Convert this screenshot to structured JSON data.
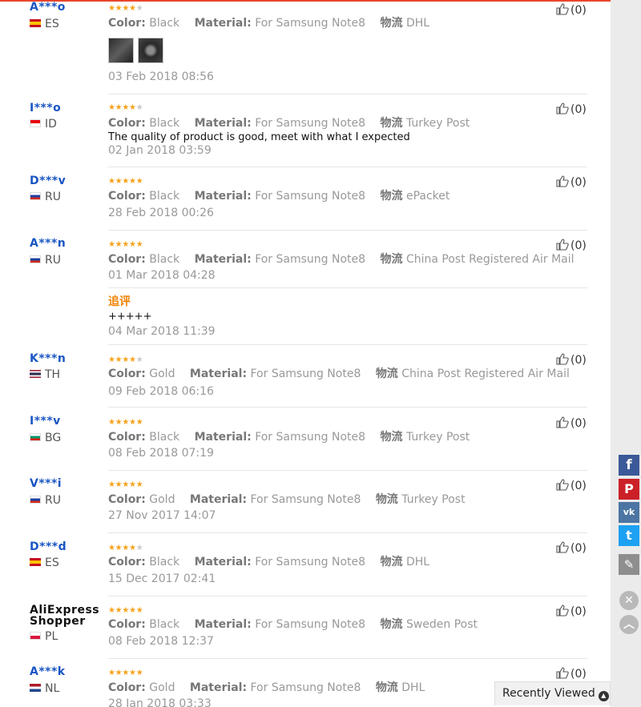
{
  "feedback": {
    "attr_labels": {
      "color": "Color:",
      "material": "Material:",
      "shipping": "物流"
    },
    "star_colors": {
      "on": "#f7a21b",
      "off": "#c9c9c9"
    },
    "reviews": [
      {
        "user": "A***o",
        "country": "ES",
        "stars": 4,
        "color": "Black",
        "material": "For Samsung Note8",
        "shipping": "DHL",
        "text": "",
        "date": "03 Feb 2018 08:56",
        "helpful": "(0)",
        "photos": 2
      },
      {
        "user": "I***o",
        "country": "ID",
        "stars": 4,
        "color": "Black",
        "material": "For Samsung Note8",
        "shipping": "Turkey Post",
        "text": "The quality of product is good, meet with what I expected",
        "date": "02 Jan 2018 03:59",
        "helpful": "(0)"
      },
      {
        "user": "D***v",
        "country": "RU",
        "stars": 5,
        "color": "Black",
        "material": "For Samsung Note8",
        "shipping": "ePacket",
        "text": "",
        "date": "28 Feb 2018 00:26",
        "helpful": "(0)"
      },
      {
        "user": "A***n",
        "country": "RU",
        "stars": 5,
        "color": "Black",
        "material": "For Samsung Note8",
        "shipping": "China Post Registered Air Mail",
        "text": "",
        "date": "01 Mar 2018 04:28",
        "helpful": "(0)",
        "append": {
          "label": "追评",
          "text": "+++++",
          "date": "04 Mar 2018 11:39"
        }
      },
      {
        "user": "K***n",
        "country": "TH",
        "stars": 4,
        "color": "Gold",
        "material": "For Samsung Note8",
        "shipping": "China Post Registered Air Mail",
        "text": "",
        "date": "09 Feb 2018 06:16",
        "helpful": "(0)"
      },
      {
        "user": "I***v",
        "country": "BG",
        "stars": 5,
        "color": "Black",
        "material": "For Samsung Note8",
        "shipping": "Turkey Post",
        "text": "",
        "date": "08 Feb 2018 07:19",
        "helpful": "(0)"
      },
      {
        "user": "V***i",
        "country": "RU",
        "stars": 5,
        "color": "Gold",
        "material": "For Samsung Note8",
        "shipping": "Turkey Post",
        "text": "",
        "date": "27 Nov 2017 14:07",
        "helpful": "(0)"
      },
      {
        "user": "D***d",
        "country": "ES",
        "stars": 4,
        "color": "Black",
        "material": "For Samsung Note8",
        "shipping": "DHL",
        "text": "",
        "date": "15 Dec 2017 02:41",
        "helpful": "(0)"
      },
      {
        "user": "AliExpress Shopper",
        "country": "PL",
        "stars": 5,
        "color": "Black",
        "material": "For Samsung Note8",
        "shipping": "Sweden Post",
        "text": "",
        "date": "08 Feb 2018 12:37",
        "helpful": "(0)"
      },
      {
        "user": "A***k",
        "country": "NL",
        "stars": 5,
        "color": "Gold",
        "material": "For Samsung Note8",
        "shipping": "DHL",
        "text": "",
        "date": "28 Jan 2018 03:33",
        "helpful": "(0)"
      }
    ]
  },
  "social": {
    "facebook": "f",
    "pinterest": "P",
    "vk": "vk",
    "twitter": "t",
    "edit": "✎"
  },
  "controls": {
    "close": "✕",
    "scroll_top": "︿"
  },
  "recently_viewed": {
    "label": "Recently Viewed",
    "icon": "chevron-up-icon"
  }
}
